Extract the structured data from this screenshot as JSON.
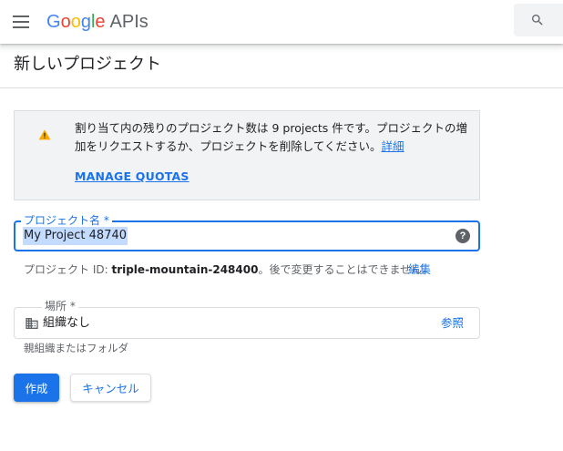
{
  "header": {
    "logo_google": [
      "G",
      "o",
      "o",
      "g",
      "l",
      "e"
    ],
    "logo_product": "APIs",
    "menu_icon": "hamburger-menu-icon",
    "search_icon": "search-icon"
  },
  "page": {
    "title": "新しいプロジェクト"
  },
  "notice": {
    "icon": "warning-icon",
    "text_before": "割り当て内の残りのプロジェクト数は 9 projects 件です。プロジェクトの増加をリクエストするか、プロジェクトを削除してください。",
    "details_link": "詳細",
    "manage_quotas": "MANAGE QUOTAS"
  },
  "project_name": {
    "label": "プロジェクト名 *",
    "value": "My Project 48740",
    "help_icon": "help-icon",
    "help_glyph": "?"
  },
  "project_id": {
    "prefix": "プロジェクト ID: ",
    "id": "triple-mountain-248400",
    "suffix": "。後で変更することはできません。",
    "edit_label": "編集"
  },
  "location": {
    "label": "場所 *",
    "value": "組織なし",
    "icon": "building-icon",
    "browse_label": "参照",
    "hint": "親組織またはフォルダ"
  },
  "actions": {
    "create_label": "作成",
    "cancel_label": "キャンセル"
  },
  "colors": {
    "primary": "#1a73e8",
    "notice_bg": "#f1f3f4",
    "warning": "#f9ab00",
    "selection": "#c2dbff"
  }
}
